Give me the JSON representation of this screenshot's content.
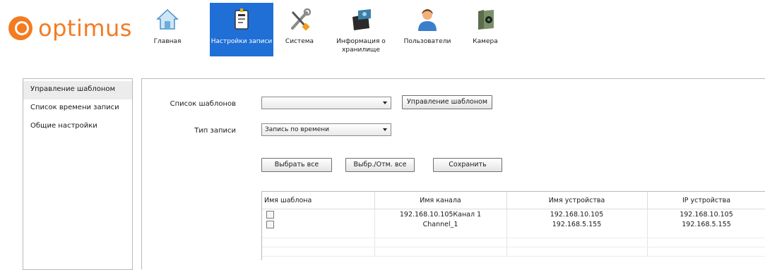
{
  "brand": {
    "name": "optimus",
    "color": "#f47b20"
  },
  "nav": {
    "items": [
      {
        "label": "Главная",
        "icon": "home-icon"
      },
      {
        "label": "Настройки записи",
        "icon": "recording-settings-icon",
        "active": true
      },
      {
        "label": "Система",
        "icon": "tools-icon"
      },
      {
        "label": "Информация о хранилище",
        "icon": "storage-icon"
      },
      {
        "label": "Пользователи",
        "icon": "users-icon"
      },
      {
        "label": "Камера",
        "icon": "camera-icon"
      }
    ],
    "active_color": "#1f6fd6"
  },
  "sidebar": {
    "items": [
      {
        "label": "Управление шаблоном",
        "active": true
      },
      {
        "label": "Список времени записи"
      },
      {
        "label": "Общие настройки"
      }
    ]
  },
  "form": {
    "template_list_label": "Список шаблонов",
    "template_list_value": "",
    "manage_template_button": "Управление шаблоном",
    "record_type_label": "Тип записи",
    "record_type_value": "Запись по времени",
    "select_all_button": "Выбрать все",
    "toggle_select_button": "Выбр./Отм. все",
    "save_button": "Сохранить"
  },
  "table": {
    "headers": [
      "Имя шаблона",
      "Имя канала",
      "Имя устройства",
      "IP устройства"
    ],
    "rows": [
      {
        "channel": "192.168.10.105Канал 1",
        "device": "192.168.10.105",
        "ip": "192.168.10.105"
      },
      {
        "channel": "Channel_1",
        "device": "192.168.5.155",
        "ip": "192.168.5.155"
      }
    ]
  }
}
